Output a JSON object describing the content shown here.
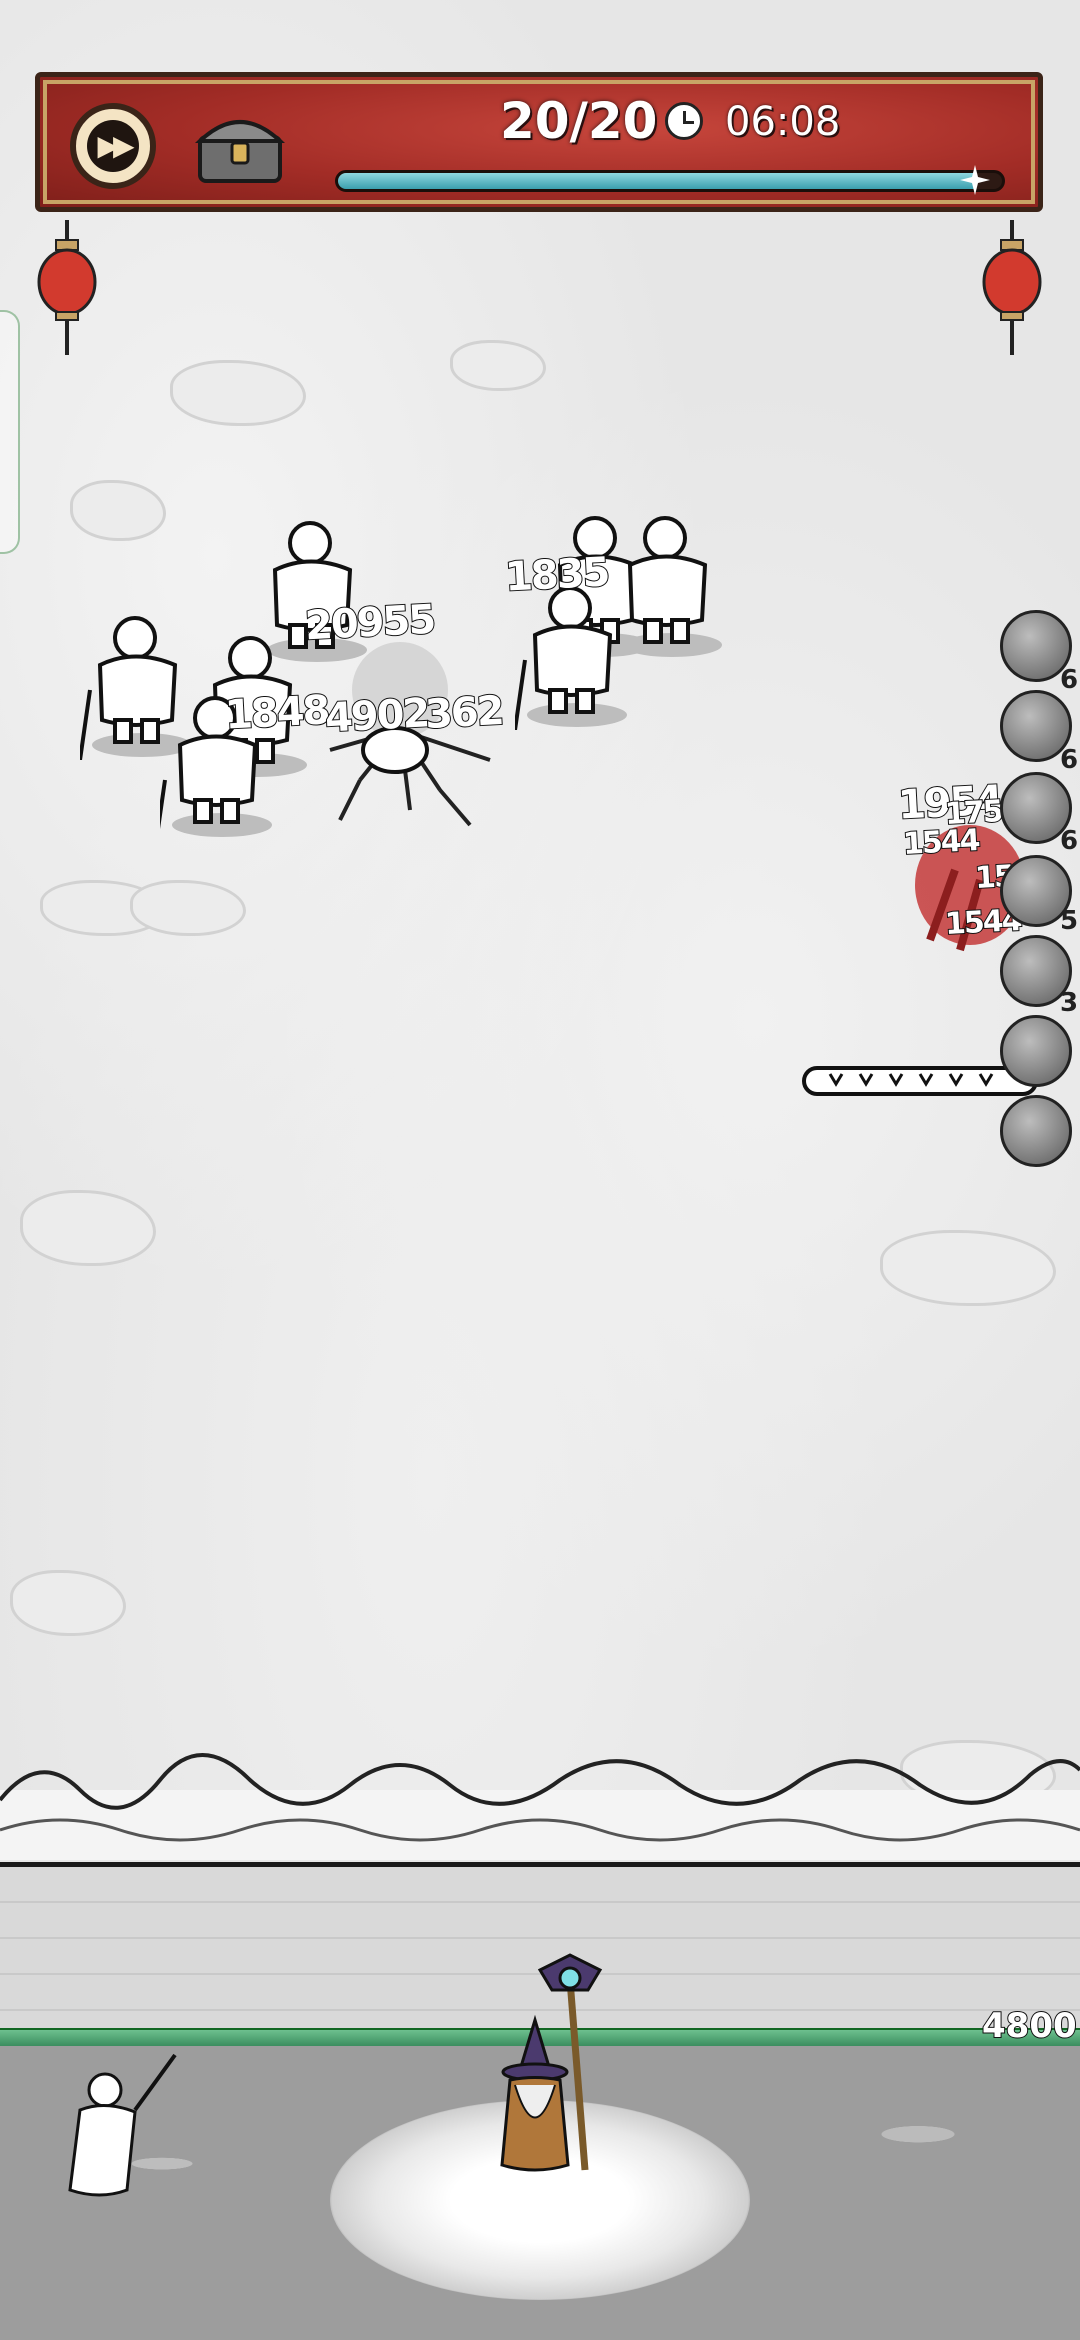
{
  "hud": {
    "wave_progress": "20/20",
    "timer": "06:08",
    "wave_bar_fraction": 0.96,
    "fast_forward_icon": "fast-forward-icon",
    "chest_icon": "treasure-chest-icon",
    "clock_icon": "clock-icon"
  },
  "damage_numbers": [
    "20955",
    "1835",
    "1848",
    "4902",
    "362",
    "1954",
    "1754",
    "1544",
    "15",
    "1544"
  ],
  "skills": [
    {
      "icon": "lightning-skill-icon",
      "level": "6"
    },
    {
      "icon": "zigzag-skill-icon",
      "level": "6"
    },
    {
      "icon": "blade-skill-icon",
      "level": "6"
    },
    {
      "icon": "ice-skill-icon",
      "level": "5"
    },
    {
      "icon": "feather-skill-icon",
      "level": "3"
    },
    {
      "icon": "drill-skill-icon",
      "level": ""
    },
    {
      "icon": "wall-skill-icon",
      "level": ""
    }
  ],
  "wall": {
    "hp": "4800",
    "hp_fraction": 1.0
  },
  "colors": {
    "banner_red": "#a22c26",
    "banner_gold": "#c8a466",
    "progress_teal": "#3b9fae",
    "hp_green": "#3b8d5f"
  }
}
